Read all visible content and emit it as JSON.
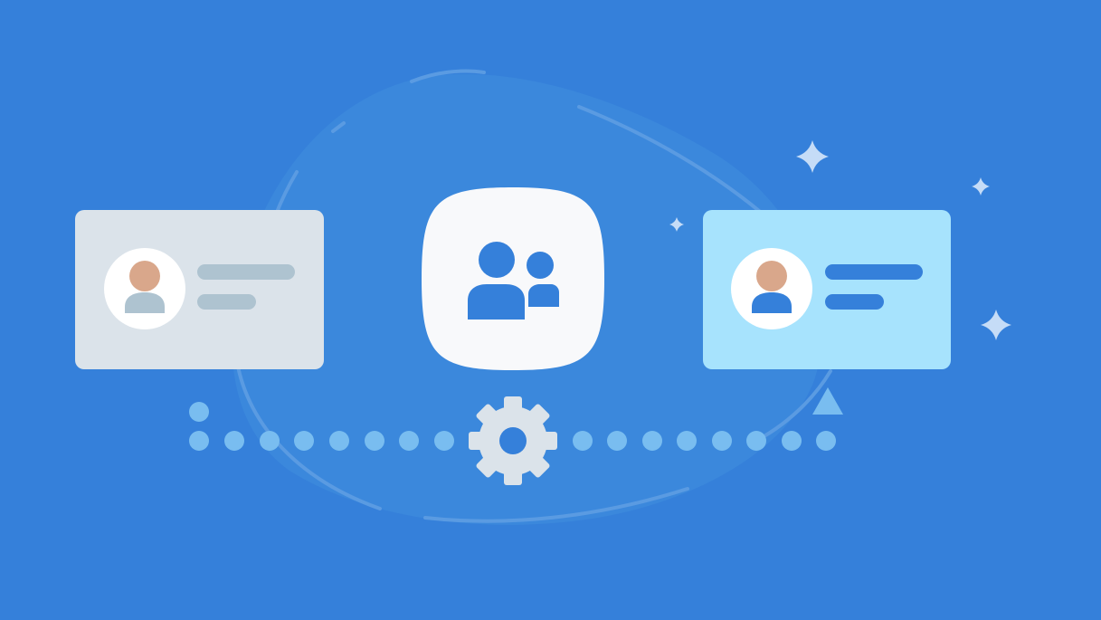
{
  "illustration": {
    "background_color": "#3580da",
    "blob_color": "#3b88dc",
    "blob_outline_color": "#5a9be2",
    "source_card": {
      "icon": "user-avatar-icon",
      "card_color": "#dbe3ea",
      "head_color": "#d9a78b",
      "body_color": "#aec3d0",
      "line_color": "#aec3d0"
    },
    "center_app_icon": {
      "icon": "user-group-icon",
      "tile_color": "#f8f9fb",
      "glyph_color": "#3580da"
    },
    "target_card": {
      "icon": "user-avatar-icon",
      "card_color": "#a7e3fd",
      "head_color": "#d9a78b",
      "body_color": "#3580da",
      "line_color": "#3580da"
    },
    "connector": {
      "dot_color": "#79bdf0",
      "gear_icon": "gear-icon",
      "gear_color": "#dbe3ea",
      "arrow_icon": "arrow-up-icon"
    },
    "sparkles": {
      "icon": "sparkle-icon",
      "color": "#c5dcf7"
    }
  }
}
